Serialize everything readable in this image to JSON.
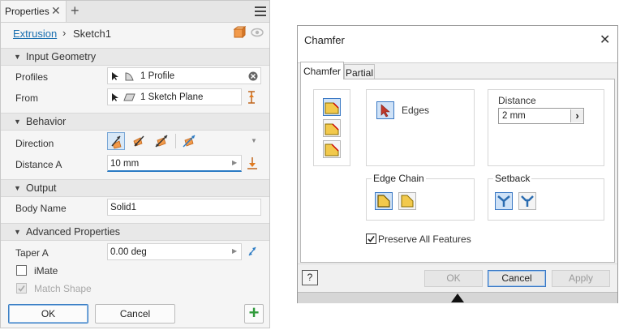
{
  "properties_panel": {
    "tab_title": "Properties",
    "tab_close": "✕",
    "tab_add": "+",
    "breadcrumb": {
      "feature": "Extrusion",
      "separator": "›",
      "sketch": "Sketch1"
    },
    "sections": {
      "input_geometry": "Input Geometry",
      "behavior": "Behavior",
      "output": "Output",
      "advanced": "Advanced Properties"
    },
    "fields": {
      "profiles_label": "Profiles",
      "profiles_value": "1 Profile",
      "from_label": "From",
      "from_value": "1 Sketch Plane",
      "direction_label": "Direction",
      "distance_a_label": "Distance A",
      "distance_a_value": "10 mm",
      "body_name_label": "Body Name",
      "body_name_value": "Solid1",
      "taper_a_label": "Taper A",
      "taper_a_value": "0.00 deg",
      "imate_label": "iMate",
      "match_shape_label": "Match Shape"
    },
    "checkboxes": {
      "imate_checked": false,
      "match_shape_checked": true,
      "match_shape_enabled": false
    },
    "buttons": {
      "ok": "OK",
      "cancel": "Cancel",
      "add": "+"
    },
    "colors": {
      "link": "#1a6fb0",
      "accent_orange": "#e07b20",
      "add_green": "#2f9a3a"
    }
  },
  "chamfer_dialog": {
    "title": "Chamfer",
    "close": "✕",
    "tabs": [
      "Chamfer",
      "Partial"
    ],
    "edges_label": "Edges",
    "distance_label": "Distance",
    "distance_value": "2 mm",
    "distance_arrow": "›",
    "edge_chain_label": "Edge Chain",
    "setback_label": "Setback",
    "preserve_label": "Preserve All Features",
    "preserve_checked": true,
    "help_glyph": "?",
    "buttons": {
      "ok": "OK",
      "cancel": "Cancel",
      "apply": "Apply"
    }
  }
}
